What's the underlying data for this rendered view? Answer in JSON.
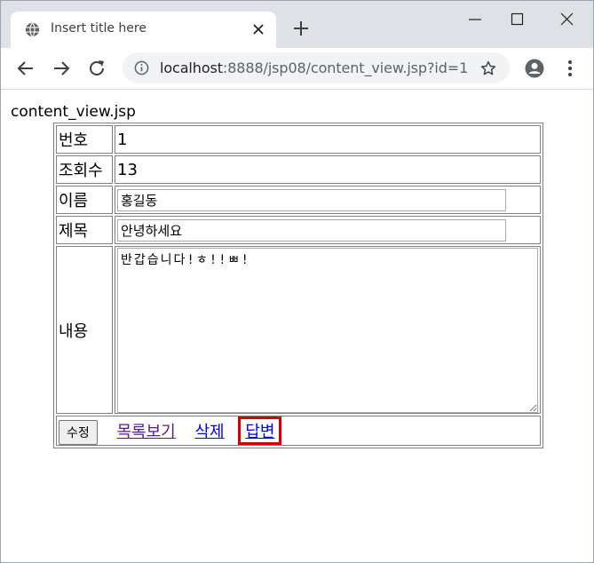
{
  "browser": {
    "tab_title": "Insert title here",
    "url_host": "localhost",
    "url_path": ":8888/jsp08/content_view.jsp?id=1"
  },
  "page": {
    "heading": "content_view.jsp",
    "rows": {
      "num": {
        "label": "번호",
        "value": "1"
      },
      "hit": {
        "label": "조회수",
        "value": "13"
      },
      "name": {
        "label": "이름",
        "value": "홍길동"
      },
      "title": {
        "label": "제목",
        "value": "안녕하세요"
      },
      "content": {
        "label": "내용",
        "value": "반갑습니다!ㅎ!!ㅃ!"
      }
    },
    "actions": {
      "edit": "수정",
      "list": "목록보기",
      "delete": "삭제",
      "reply": "답변"
    }
  },
  "colors": {
    "highlight": "#d40000",
    "link": "#0000ee",
    "visited_link": "#551a8b"
  }
}
